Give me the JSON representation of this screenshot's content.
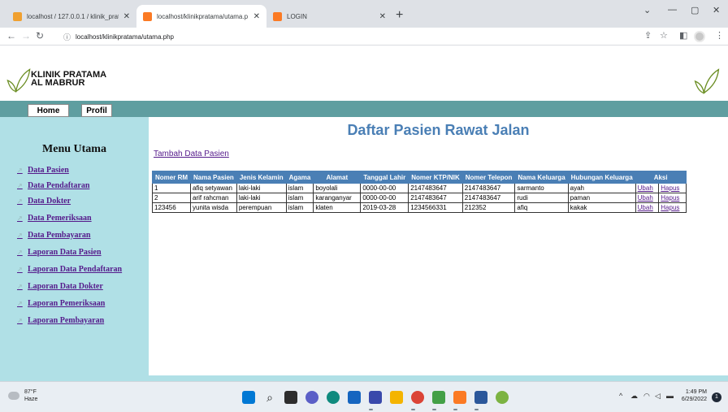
{
  "browser": {
    "tabs": [
      {
        "title": "localhost / 127.0.0.1 / klinik_prat"
      },
      {
        "title": "localhost/klinikpratama/utama.p"
      },
      {
        "title": "LOGIN"
      }
    ],
    "address": "localhost/klinikpratama/utama.php"
  },
  "header": {
    "clinic_line1": "KLINIK PRATAMA",
    "clinic_line2": "AL MABRUR"
  },
  "nav": {
    "home": "Home",
    "profil": "Profil"
  },
  "sidebar": {
    "title": "Menu Utama",
    "items": [
      {
        "label": "Data Pasien"
      },
      {
        "label": "Data Pendaftaran"
      },
      {
        "label": "Data Dokter"
      },
      {
        "label": "Data Pemeriksaan"
      },
      {
        "label": "Data Pembayaran"
      },
      {
        "label": "Laporan Data Pasien"
      },
      {
        "label": "Laporan Data Pendaftaran"
      },
      {
        "label": "Laporan Data Dokter"
      },
      {
        "label": "Laporan Pemeriksaan"
      },
      {
        "label": "Laporan Pembayaran"
      }
    ]
  },
  "main": {
    "title": "Daftar Pasien Rawat Jalan",
    "add_link": "Tambah Data Pasien",
    "table": {
      "headers": [
        "Nomer RM",
        "Nama Pasien",
        "Jenis Kelamin",
        "Agama",
        "Alamat",
        "Tanggal Lahir",
        "Nomer KTP/NIK",
        "Nomer Telepon",
        "Nama Keluarga",
        "Hubungan Keluarga",
        "Aksi"
      ],
      "rows": [
        [
          "1",
          "afiq setyawan",
          "laki-laki",
          "islam",
          "boyolali",
          "0000-00-00",
          "2147483647",
          "2147483647",
          "sarmanto",
          "ayah"
        ],
        [
          "2",
          "arif rahcman",
          "laki-laki",
          "islam",
          "karanganyar",
          "0000-00-00",
          "2147483647",
          "2147483647",
          "rudi",
          "paman"
        ],
        [
          "123456",
          "yunita wisda",
          "perempuan",
          "islam",
          "klaten",
          "2019-03-28",
          "1234566331",
          "212352",
          "afiq",
          "kakak"
        ]
      ],
      "action_edit": "Ubah",
      "action_delete": "Hapus"
    }
  },
  "taskbar": {
    "temp": "87°F",
    "weather": "Haze",
    "time": "1:49 PM",
    "date": "6/29/2022",
    "notification_count": "1"
  },
  "colors": {
    "navbar": "#5f9ea0",
    "sidebar": "#b0e0e6",
    "table_header": "#4a7fb5",
    "title": "#4a7fb5",
    "link": "#551a8b"
  }
}
